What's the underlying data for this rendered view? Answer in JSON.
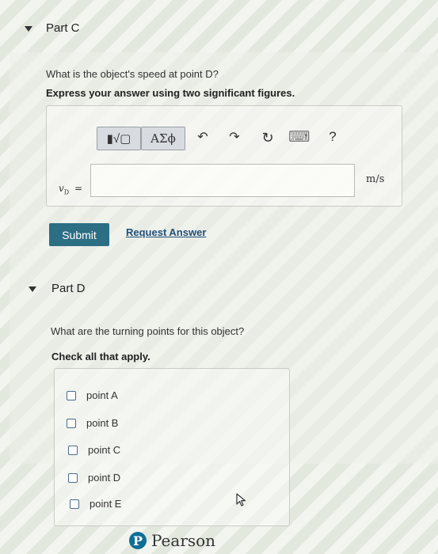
{
  "part_c": {
    "title": "Part C",
    "question": "What is the object's speed at point D?",
    "instruction": "Express your answer using two significant figures.",
    "toolbar": {
      "templates_icon": "▮√▢",
      "greek_symbols": "ΑΣϕ",
      "undo_icon": "↶",
      "redo_icon": "↷",
      "reset_icon": "↻",
      "keyboard_icon": "⌨",
      "help": "?"
    },
    "variable": "v",
    "variable_subscript": "D",
    "equals": "=",
    "input_value": "",
    "unit": "m/s",
    "submit_label": "Submit",
    "request_answer_label": "Request Answer"
  },
  "part_d": {
    "title": "Part D",
    "question": "What are the turning points for this object?",
    "instruction": "Check all that apply.",
    "options": [
      {
        "label": "point A",
        "checked": false
      },
      {
        "label": "point B",
        "checked": false
      },
      {
        "label": "point C",
        "checked": false
      },
      {
        "label": "point D",
        "checked": false
      },
      {
        "label": "point E",
        "checked": false
      }
    ]
  },
  "footer": {
    "brand_letter": "P",
    "brand_name": "Pearson"
  },
  "colors": {
    "submit_bg": "#2c6e84",
    "link": "#1f4f78",
    "pearson_blue": "#0d6f94"
  }
}
